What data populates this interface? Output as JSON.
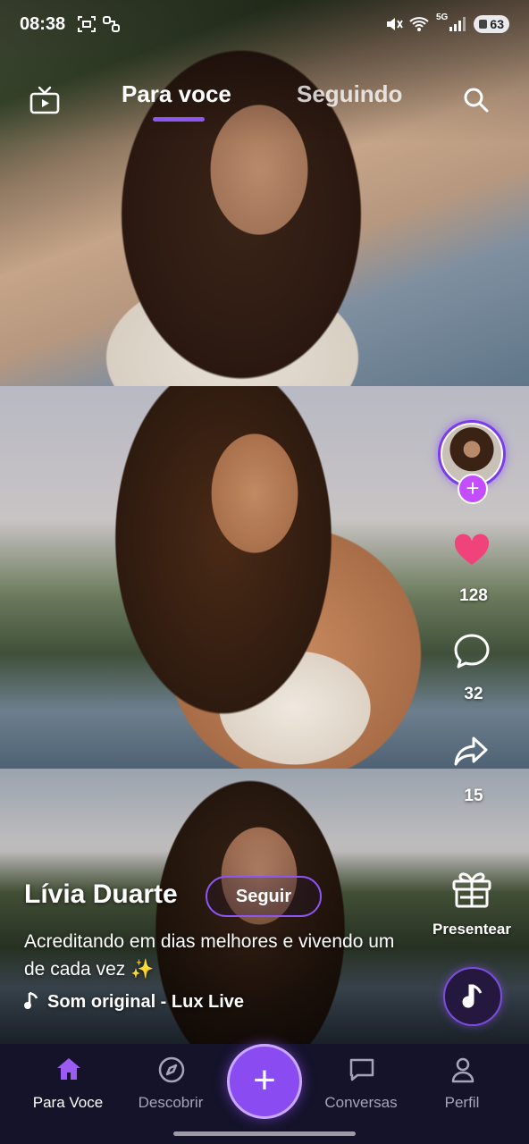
{
  "status_bar": {
    "time": "08:38",
    "battery": "63",
    "network": "5G"
  },
  "top_tabs": {
    "for_you": "Para voce",
    "following": "Seguindo",
    "active": "for_you"
  },
  "post": {
    "author_name": "Lívia Duarte",
    "follow_label": "Seguir",
    "caption": "Acreditando em dias melhores e vivendo um de cada vez ✨",
    "sound": "Som original - Lux Live",
    "likes": "128",
    "comments": "32",
    "shares": "15",
    "gift_label": "Presentear"
  },
  "bottom_nav": {
    "items": [
      {
        "label": "Para Voce",
        "icon": "home-icon",
        "active": true
      },
      {
        "label": "Descobrir",
        "icon": "compass-icon",
        "active": false
      },
      {
        "label": "Conversas",
        "icon": "chat-icon",
        "active": false
      },
      {
        "label": "Perfil",
        "icon": "user-icon",
        "active": false
      }
    ],
    "create_icon": "plus-icon"
  },
  "colors": {
    "accent": "#8e55f5",
    "like": "#f0437c",
    "nav_background": "#15132a"
  }
}
